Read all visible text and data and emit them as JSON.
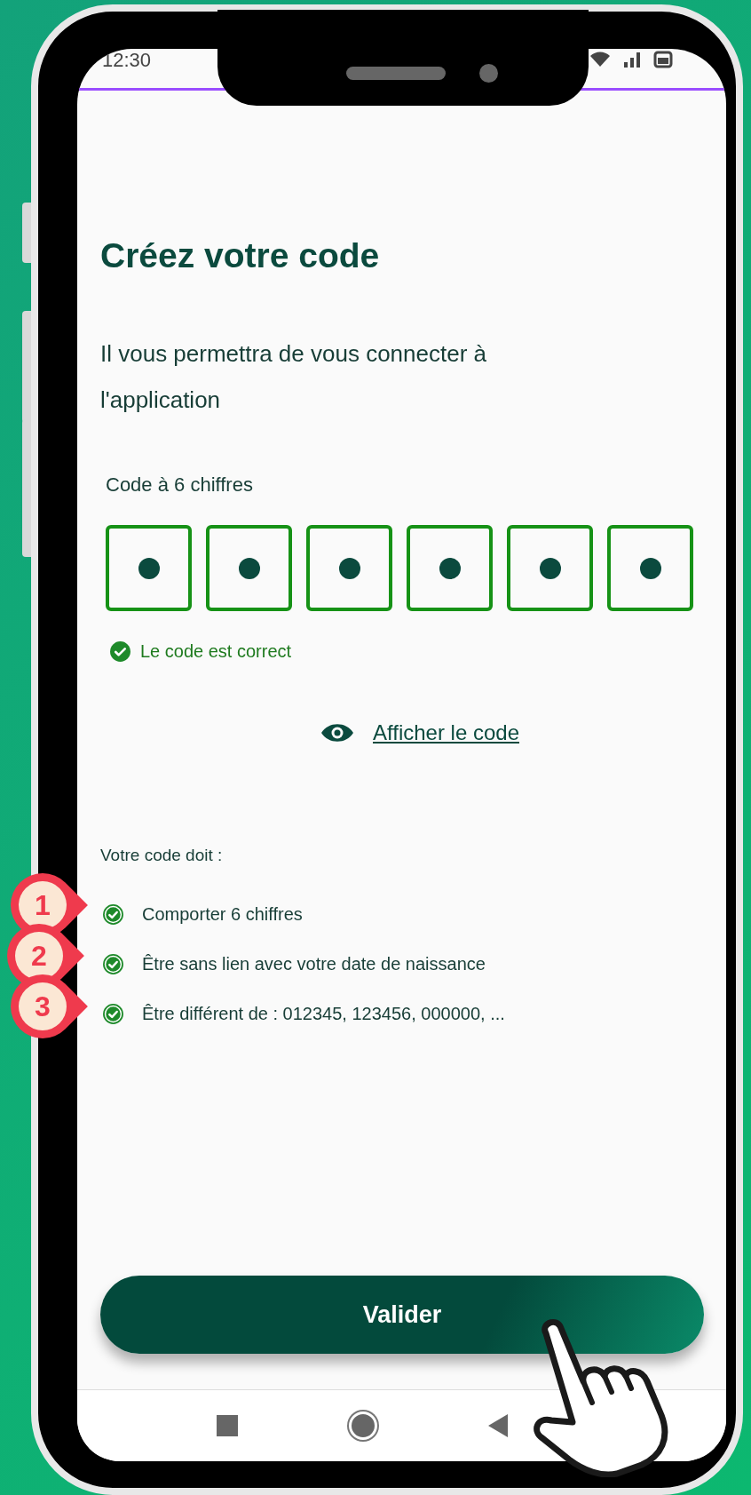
{
  "status_bar": {
    "time": "12:30"
  },
  "title": "Créez votre code",
  "subtitle": "Il vous permettra de vous connecter à l'application",
  "code_field": {
    "label": "Code à 6 chiffres",
    "digits": [
      {
        "filled": true
      },
      {
        "filled": true
      },
      {
        "filled": true
      },
      {
        "filled": true
      },
      {
        "filled": true
      },
      {
        "filled": true
      }
    ],
    "message": {
      "kind": "success",
      "text": "Le code est correct"
    }
  },
  "show_code_link": "Afficher le code",
  "rules": {
    "heading": "Votre code doit :",
    "items": [
      {
        "text": "Comporter 6 chiffres",
        "met": true
      },
      {
        "text": "Être sans lien avec votre date de naissance",
        "met": true
      },
      {
        "text": "Être différent de : 012345, 123456, 000000, ...",
        "met": true
      }
    ]
  },
  "markers": [
    "1",
    "2",
    "3"
  ],
  "button": "Valider"
}
